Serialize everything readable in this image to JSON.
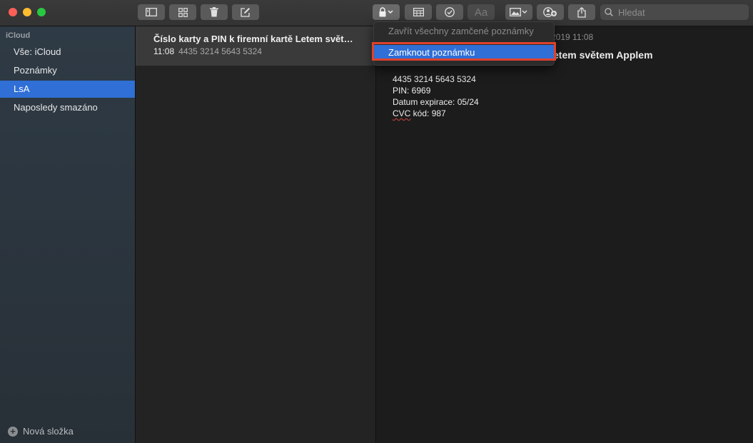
{
  "toolbar": {
    "search_placeholder": "Hledat",
    "format_label": "Aa"
  },
  "sidebar": {
    "account": "iCloud",
    "items": [
      {
        "label": "Vše: iCloud",
        "selected": false
      },
      {
        "label": "Poznámky",
        "selected": false
      },
      {
        "label": "LsA",
        "selected": true
      },
      {
        "label": "Naposledy smazáno",
        "selected": false
      }
    ],
    "new_folder_label": "Nová složka"
  },
  "note_list": {
    "notes": [
      {
        "title": "Číslo karty a PIN k firemní kartě Letem svět…",
        "time": "11:08",
        "preview": "4435 3214 5643 5324"
      }
    ]
  },
  "editor": {
    "date_fragment": "a 2019 11:08",
    "title_fragment": "etem světem Applem",
    "lines": [
      "4435 3214 5643 5324",
      "PIN: 6969",
      "Datum expirace: 05/24"
    ],
    "cvc_word": "CVC",
    "cvc_rest": " kód: 987"
  },
  "lock_menu": {
    "items": [
      {
        "label": "Zavřít všechny zamčené poznámky",
        "enabled": false
      },
      {
        "label": "Zamknout poznámku",
        "enabled": true,
        "highlighted": true
      }
    ]
  },
  "colors": {
    "accent": "#2f6fd6",
    "annotation_box": "#e0412b",
    "close": "#fe5f57",
    "minimize": "#febc2e",
    "zoom": "#28c840"
  }
}
